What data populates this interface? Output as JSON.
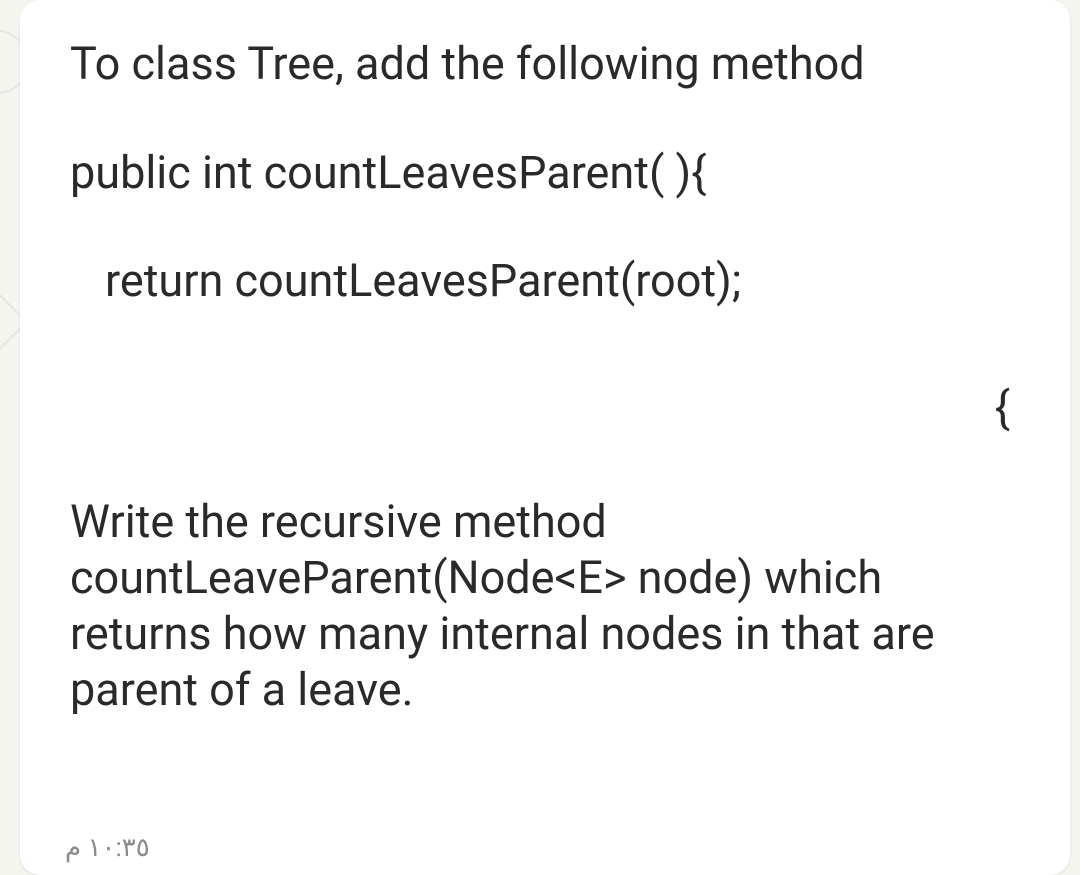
{
  "message": {
    "line1": "To class Tree, add the following method",
    "line2": "public int countLeavesParent( ){",
    "line3": "return countLeavesParent(root);",
    "brace": "{",
    "paragraph": "Write the recursive method countLeaveParent(Node<E> node) which returns how many internal nodes in that are parent of a leave.",
    "timestamp": "١٠:٣٥ م"
  }
}
